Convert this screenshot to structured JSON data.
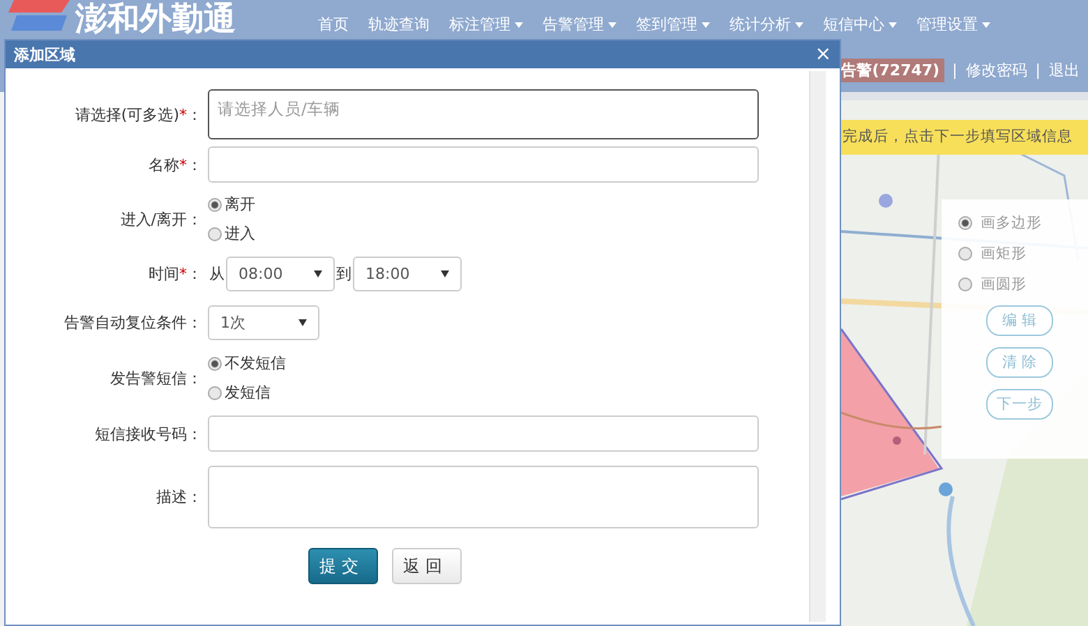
{
  "header": {
    "logo": "澎和外勤通",
    "nav": [
      {
        "label": "首页",
        "dropdown": false
      },
      {
        "label": "轨迹查询",
        "dropdown": false
      },
      {
        "label": "标注管理",
        "dropdown": true
      },
      {
        "label": "告警管理",
        "dropdown": true
      },
      {
        "label": "签到管理",
        "dropdown": true
      },
      {
        "label": "统计分析",
        "dropdown": true
      },
      {
        "label": "短信中心",
        "dropdown": true
      },
      {
        "label": "管理设置",
        "dropdown": true
      }
    ],
    "user_bar": [
      {
        "kind": "badge",
        "text": "告警(72747)"
      },
      {
        "kind": "sep",
        "text": "|"
      },
      {
        "kind": "link",
        "text": "修改密码"
      },
      {
        "kind": "sep",
        "text": "|"
      },
      {
        "kind": "link",
        "text": "退出"
      }
    ]
  },
  "map": {
    "hint": "完成后，点击下一步填写区域信息",
    "shapes": [
      {
        "label": "画多边形",
        "selected": true
      },
      {
        "label": "画矩形",
        "selected": false
      },
      {
        "label": "画圆形",
        "selected": false
      }
    ],
    "buttons": [
      "编 辑",
      "清 除",
      "下一步"
    ]
  },
  "dialog": {
    "title": "添加区域",
    "close": "×",
    "rows": [
      {
        "kind": "multi",
        "label": "请选择(可多选)",
        "mark": "*",
        "colon": "：",
        "placeholder": "请选择人员/车辆"
      },
      {
        "kind": "text",
        "label": "名称",
        "mark": "*",
        "colon": "："
      },
      {
        "kind": "radio",
        "label": "进入/离开",
        "colon": "：",
        "options": [
          {
            "label": "离开",
            "selected": true
          },
          {
            "label": "进入",
            "selected": false
          }
        ]
      },
      {
        "kind": "time",
        "label": "时间",
        "mark": "*",
        "colon": "：",
        "from": "从",
        "from_value": "08:00",
        "to": "到",
        "to_value": "18:00"
      },
      {
        "kind": "select",
        "label": "告警自动复位条件",
        "colon": "：",
        "value": "1次"
      },
      {
        "kind": "radio",
        "label": "发告警短信",
        "colon": "：",
        "options": [
          {
            "label": "不发短信",
            "selected": true
          },
          {
            "label": "发短信",
            "selected": false
          }
        ]
      },
      {
        "kind": "text",
        "label": "短信接收号码",
        "colon": "："
      },
      {
        "kind": "textarea",
        "label": "描述",
        "colon": "："
      }
    ],
    "buttons": [
      {
        "label": "提交",
        "primary": true
      },
      {
        "label": "返回",
        "primary": false
      }
    ]
  }
}
